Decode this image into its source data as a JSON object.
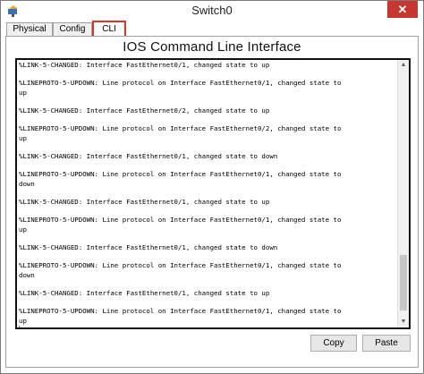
{
  "window": {
    "title": "Switch0",
    "close_glyph": "✕"
  },
  "tabs": [
    {
      "label": "Physical"
    },
    {
      "label": "Config"
    },
    {
      "label": "CLI"
    }
  ],
  "panel": {
    "heading": "IOS Command Line Interface"
  },
  "console": {
    "lines": [
      "%LINK-5-CHANGED: Interface FastEthernet0/1, changed state to up",
      "",
      "%LINEPROTO-5-UPDOWN: Line protocol on Interface FastEthernet0/1, changed state to",
      "up",
      "",
      "%LINK-5-CHANGED: Interface FastEthernet0/2, changed state to up",
      "",
      "%LINEPROTO-5-UPDOWN: Line protocol on Interface FastEthernet0/2, changed state to",
      "up",
      "",
      "%LINK-5-CHANGED: Interface FastEthernet0/1, changed state to down",
      "",
      "%LINEPROTO-5-UPDOWN: Line protocol on Interface FastEthernet0/1, changed state to",
      "down",
      "",
      "%LINK-5-CHANGED: Interface FastEthernet0/1, changed state to up",
      "",
      "%LINEPROTO-5-UPDOWN: Line protocol on Interface FastEthernet0/1, changed state to",
      "up",
      "",
      "%LINK-5-CHANGED: Interface FastEthernet0/1, changed state to down",
      "",
      "%LINEPROTO-5-UPDOWN: Line protocol on Interface FastEthernet0/1, changed state to",
      "down",
      "",
      "%LINK-5-CHANGED: Interface FastEthernet0/1, changed state to up",
      "",
      "%LINEPROTO-5-UPDOWN: Line protocol on Interface FastEthernet0/1, changed state to",
      "up"
    ],
    "cursor": "▏"
  },
  "buttons": {
    "copy": "Copy",
    "paste": "Paste"
  },
  "icons": {
    "app": "packet-tracer-icon",
    "scroll_up": "▲",
    "scroll_down": "▼"
  },
  "colors": {
    "active_tab_border": "#d9372a",
    "close_button": "#c7372f"
  }
}
